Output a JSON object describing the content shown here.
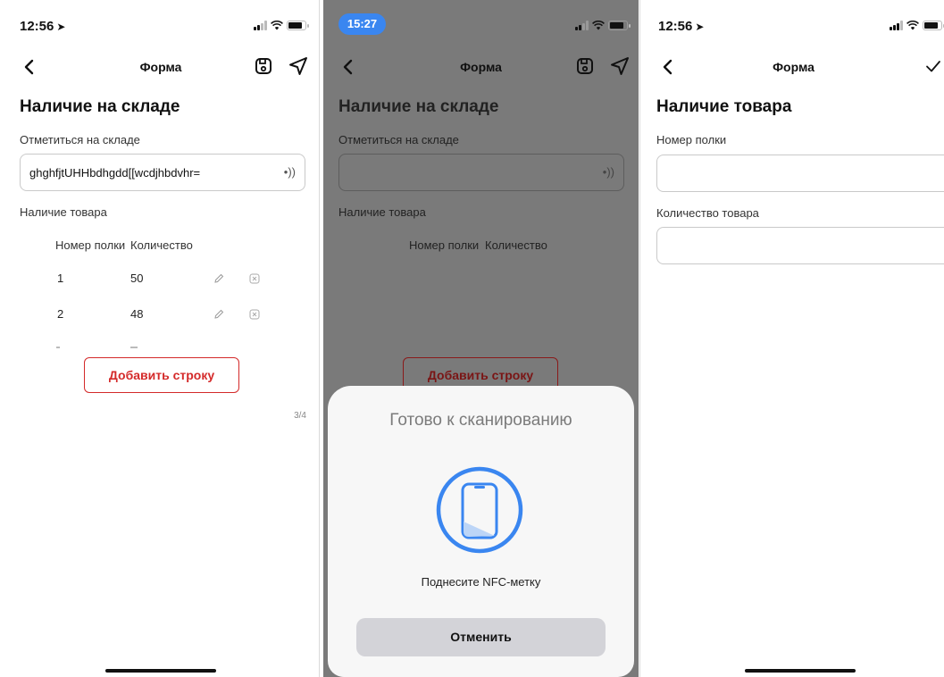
{
  "screen1": {
    "status_time": "12:56",
    "nav_title": "Форма",
    "heading": "Наличие на складе",
    "checkin_label": "Отметиться на складе",
    "checkin_value": "ghghfjtUHHbdhgdd[[wcdjhbdvhr=",
    "stock_label": "Наличие товара",
    "columns": [
      "Номер полки",
      "Количество"
    ],
    "rows": [
      {
        "shelf": "1",
        "qty": "50"
      },
      {
        "shelf": "2",
        "qty": "48"
      }
    ],
    "add_row_label": "Добавить строку",
    "pager": "3/4"
  },
  "screen2": {
    "status_time": "15:27",
    "nav_title": "Форма",
    "heading": "Наличие на складе",
    "checkin_label": "Отметиться на складе",
    "stock_label": "Наличие товара",
    "columns": [
      "Номер полки",
      "Количество"
    ],
    "add_row_label": "Добавить строку",
    "sheet": {
      "title": "Готово к сканированию",
      "hint": "Поднесите NFC-метку",
      "cancel_label": "Отменить",
      "accent": "#3a86f0"
    }
  },
  "screen3": {
    "status_time": "12:56",
    "nav_title": "Форма",
    "heading": "Наличие товара",
    "shelf_label": "Номер полки",
    "qty_label": "Количество товара"
  },
  "icons": {
    "back": "chevron-left-icon",
    "save": "save-icon",
    "send": "send-icon",
    "nfc": "nfc-icon",
    "edit": "pencil-icon",
    "delete": "delete-icon",
    "confirm": "checkmark-icon"
  },
  "colors": {
    "accent_red": "#d42a2a",
    "overlay": "#7a7a7a",
    "ios_blue": "#3a86f0"
  }
}
